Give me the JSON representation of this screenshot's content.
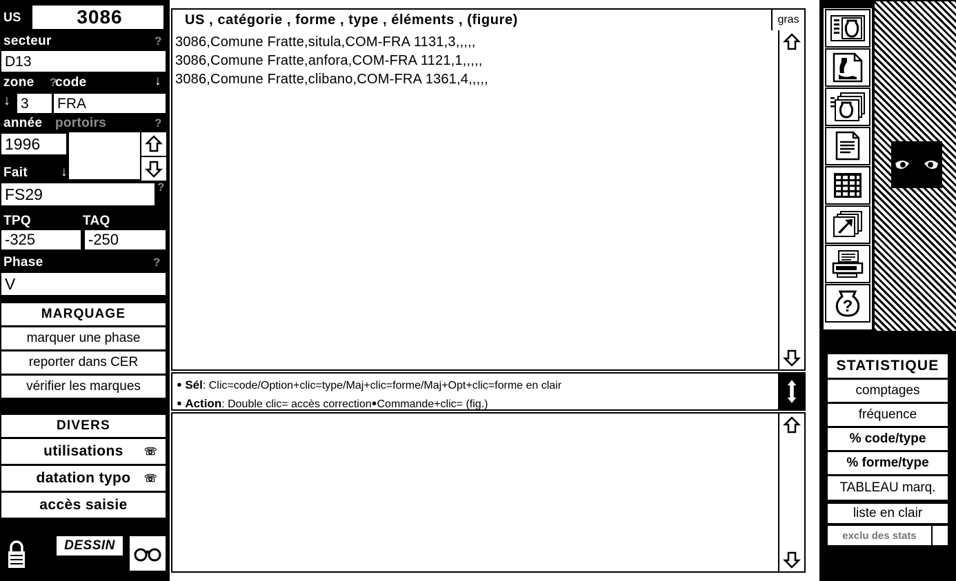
{
  "sidebar": {
    "us": {
      "label": "US",
      "value": "3086"
    },
    "secteur": {
      "label": "secteur",
      "value": "D13",
      "hint": "?"
    },
    "zone": {
      "label": "zone",
      "value": "3",
      "hint": "?",
      "arrow": "↓"
    },
    "code": {
      "label": "code",
      "value": "FRA",
      "arrow": "↓"
    },
    "annee": {
      "label": "année",
      "value": "1996"
    },
    "portoirs": {
      "label": "portoirs",
      "value": "",
      "hint": "?"
    },
    "fait": {
      "label": "Fait",
      "value": "FS29",
      "hint": "?",
      "arrow": "↓"
    },
    "tpq": {
      "label": "TPQ",
      "value": "-325"
    },
    "taq": {
      "label": "TAQ",
      "value": "-250"
    },
    "phase": {
      "label": "Phase",
      "value": "V",
      "hint": "?"
    },
    "marquage": {
      "title": "MARQUAGE",
      "items": [
        {
          "label": "marquer une phase"
        },
        {
          "label": "reporter dans CER"
        },
        {
          "label": "vérifier les marques"
        }
      ]
    },
    "divers": {
      "title": "DIVERS",
      "items": [
        {
          "label": "utilisations",
          "glyph": "☏"
        },
        {
          "label": "datation typo",
          "glyph": "☏"
        },
        {
          "label": "accès saisie",
          "glyph": ""
        }
      ]
    },
    "bottom": {
      "lock_icon": "lock-icon",
      "dessin_label": "DESSIN",
      "glasses_icon": "glasses-icon"
    }
  },
  "main": {
    "header": {
      "columns": "US  ,  catégorie  ,  forme  ,  type  ,  éléments  , (figure)",
      "gras_label": "gras"
    },
    "rows": [
      "3086,Comune Fratte,situla,COM-FRA 1131,3,,,,,",
      "3086,Comune Fratte,anfora,COM-FRA 1121,1,,,,,",
      "3086,Comune Fratte,clibano,COM-FRA 1361,4,,,,,"
    ],
    "info": {
      "line1_label": "Sél",
      "line1_text": ": Clic=code/Option+clic=type/Maj+clic=forme/Maj+Opt+clic=forme en clair",
      "line2_label": "Action",
      "line2_text": ": Double clic= accès correction",
      "line2_text2": "Commande+clic=  (fig.)"
    },
    "scroll": {
      "up_icon": "arrow-up-icon",
      "down_icon": "arrow-down-icon",
      "thumb_icon": "arrow-up-down-icon"
    }
  },
  "right": {
    "toolbar": [
      {
        "name": "vase-record-icon"
      },
      {
        "name": "drawing-document-icon"
      },
      {
        "name": "vase-stack-icon"
      },
      {
        "name": "text-document-icon"
      },
      {
        "name": "table-grid-icon"
      },
      {
        "name": "slides-arrow-icon"
      },
      {
        "name": "printer-icon"
      },
      {
        "name": "vase-help-icon"
      }
    ],
    "mask_image": "mask-face-image",
    "statistique": {
      "title": "STATISTIQUE",
      "items": [
        {
          "label": "comptages"
        },
        {
          "label": "fréquence"
        },
        {
          "label": "% code/type"
        },
        {
          "label": "% forme/type"
        },
        {
          "label": "TABLEAU marq."
        },
        {
          "label": "liste en clair"
        },
        {
          "label": "exclu des stats"
        }
      ]
    }
  }
}
